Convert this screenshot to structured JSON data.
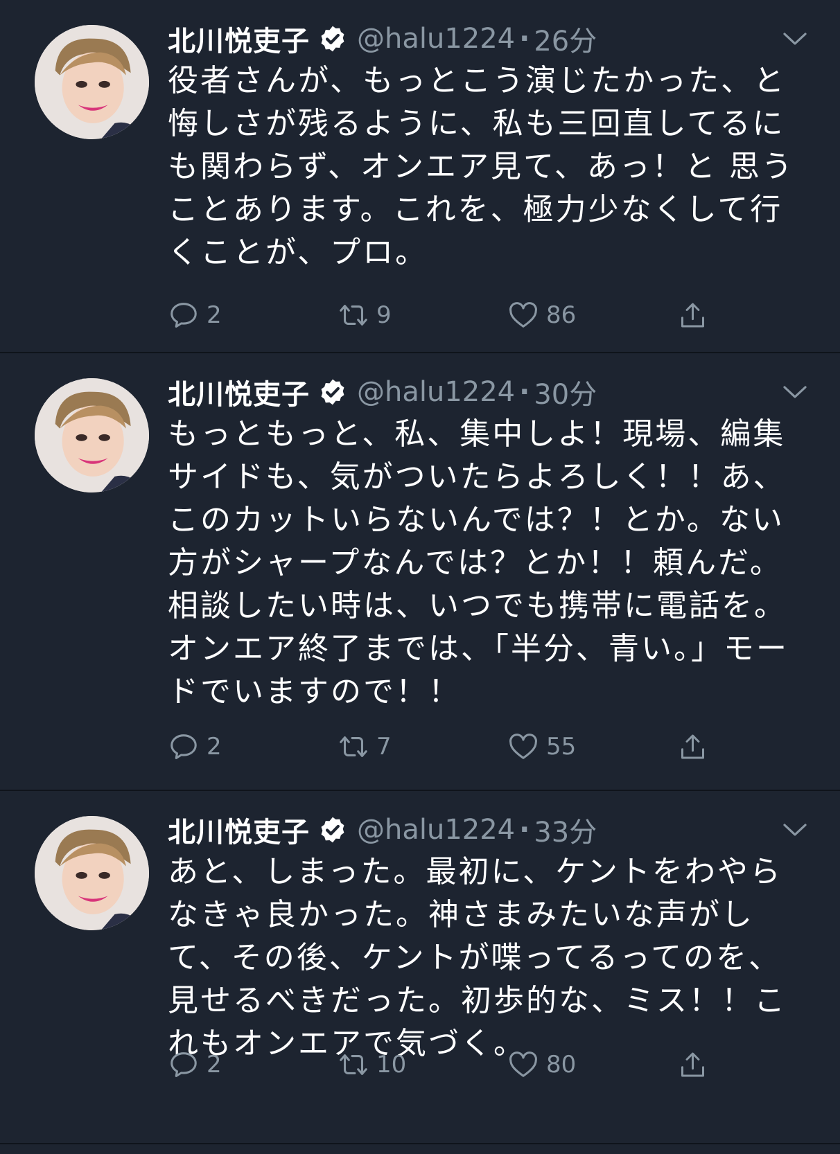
{
  "colors": {
    "background": "#1d2430",
    "divider": "#0f141b",
    "muted": "#8a97a3",
    "text": "#ffffff"
  },
  "icons": {
    "reply": "speech-bubble",
    "retweet": "retweet-arrows",
    "like": "heart-outline",
    "share": "share-upload",
    "verified": "verified-badge",
    "more": "chevron-down"
  },
  "tweets": [
    {
      "name": "北川悦吏子",
      "handle": "@halu1224",
      "separator": "·",
      "time": "26分",
      "text": "役者さんが、もっとこう演じたかった、と悔しさが残るように、私も三回直してるにも関わらず、オンエア見て、あっ！と 思うことあります。これを、極力少なくして行くことが、プロ。",
      "replies": "2",
      "retweets": "9",
      "likes": "86"
    },
    {
      "name": "北川悦吏子",
      "handle": "@halu1224",
      "separator": "·",
      "time": "30分",
      "text": "もっともっと、私、集中しよ！現場、編集サイドも、気がついたらよろしく！！あ、このカットいらないんでは？！とか。ない方がシャープなんでは？とか！！頼んだ。相談したい時は、いつでも携帯に電話を。オンエア終了までは、「半分、青い。」モードでいますので！！",
      "replies": "2",
      "retweets": "7",
      "likes": "55"
    },
    {
      "name": "北川悦吏子",
      "handle": "@halu1224",
      "separator": "·",
      "time": "33分",
      "text": "あと、しまった。最初に、ケントをわやらなきゃ良かった。神さまみたいな声がして、その後、ケントが喋ってるってのを、見せるべきだった。初歩的な、ミス！！これもオンエアで気づく。",
      "replies": "2",
      "retweets": "10",
      "likes": "80"
    }
  ]
}
